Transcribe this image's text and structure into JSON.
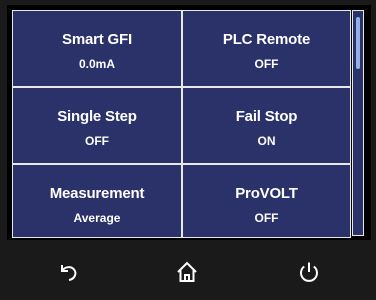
{
  "settings": [
    {
      "title": "Smart GFI",
      "value": "0.0mA"
    },
    {
      "title": "PLC Remote",
      "value": "OFF"
    },
    {
      "title": "Single Step",
      "value": "OFF"
    },
    {
      "title": "Fail Stop",
      "value": "ON"
    },
    {
      "title": "Measurement",
      "value": "Average"
    },
    {
      "title": "ProVOLT",
      "value": "OFF"
    }
  ],
  "nav": {
    "back_icon": "back-arrow-icon",
    "home_icon": "home-icon",
    "power_icon": "power-icon"
  },
  "colors": {
    "panel": "#2b3169",
    "grid_lines": "#e8e8e8",
    "text": "#ffffff",
    "scroll_thumb": "#8fb0e8",
    "bezel": "#1a1a1a"
  }
}
